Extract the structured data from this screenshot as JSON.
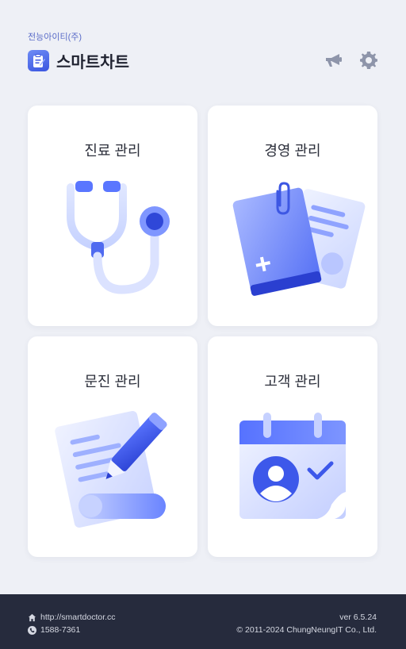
{
  "header": {
    "company": "전능아이티(주)",
    "app_title": "스마트차트",
    "icons": [
      "megaphone-icon",
      "gear-icon"
    ]
  },
  "cards": [
    {
      "label": "진료 관리",
      "icon": "stethoscope-icon"
    },
    {
      "label": "경영 관리",
      "icon": "documents-icon"
    },
    {
      "label": "문진 관리",
      "icon": "pencil-paper-icon"
    },
    {
      "label": "고객 관리",
      "icon": "calendar-user-icon"
    }
  ],
  "footer": {
    "website": "http://smartdoctor.cc",
    "phone": "1588-7361",
    "version": "ver 6.5.24",
    "copyright": "© 2011-2024 ChungNeungIT Co., Ltd."
  },
  "colors": {
    "accent": "#3a55e0",
    "background": "#eef0f6",
    "footer": "#262b3d"
  }
}
